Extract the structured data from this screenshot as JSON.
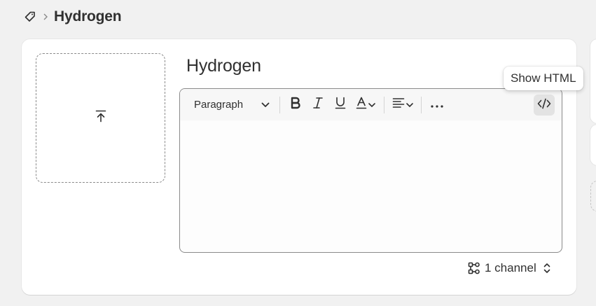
{
  "breadcrumb": {
    "icon": "tag-icon",
    "separator_icon": "chevron-right-icon",
    "title": "Hydrogen"
  },
  "media": {
    "icon": "upload-icon"
  },
  "product": {
    "title": "Hydrogen"
  },
  "editor": {
    "format_label": "Paragraph",
    "tools": [
      "bold-icon",
      "italic-icon",
      "underline-icon",
      "text-color-icon",
      "align-icon",
      "more-icon",
      "code-icon"
    ]
  },
  "tooltip": {
    "text": "Show HTML"
  },
  "channel": {
    "label": "1 channel",
    "icon": "channels-icon"
  },
  "colors": {
    "background": "#f1f1f1",
    "card": "#ffffff",
    "border": "#8a8a8a",
    "text": "#303030"
  }
}
